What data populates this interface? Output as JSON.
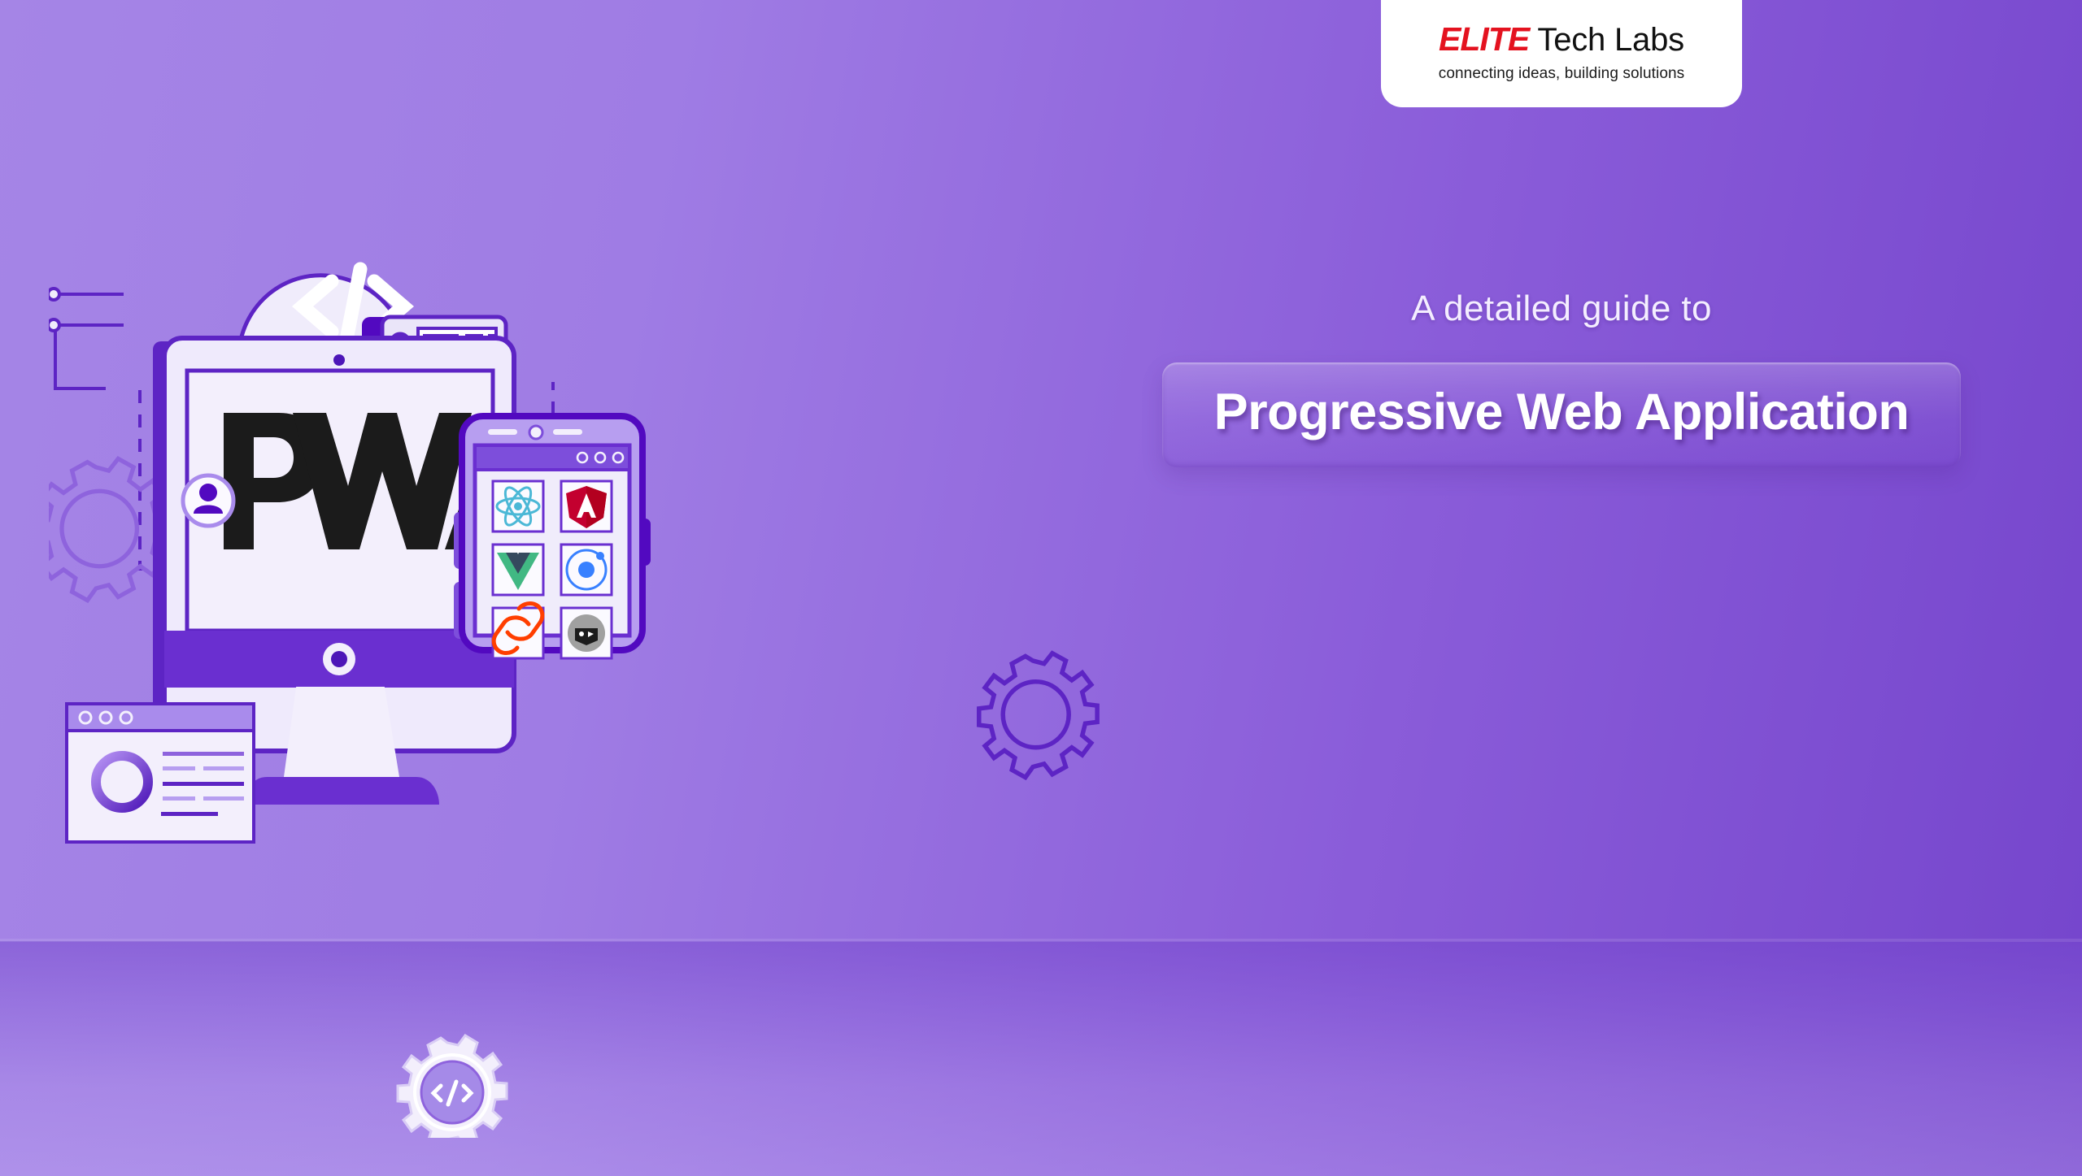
{
  "brand": {
    "logo_primary": "ELITE",
    "logo_secondary": " Tech Labs",
    "tagline": "connecting ideas, building solutions",
    "logo_red": "#e4121f",
    "logo_dark": "#111111"
  },
  "headline": {
    "eyebrow": "A detailed guide to",
    "title": "Progressive Web Application"
  },
  "colors": {
    "background_left": "#a585e6",
    "background_right": "#7545cc",
    "accent_purple": "#6a2fd0",
    "deep_purple": "#4d16b8",
    "panel_white": "#f0ecfb",
    "floor_overlay": "#b18ef0"
  },
  "illustration": {
    "screen_logo": "PWA",
    "code_symbol": "</>",
    "cloud_label": "cloud-node-network",
    "server_count": 3,
    "monitor": {
      "label": "desktop-monitor",
      "screen_text": "PWA"
    },
    "browser_card": {
      "label": "browser-window-card",
      "dots": 3,
      "chart": "donut-chart"
    },
    "phone": {
      "label": "smartphone",
      "browser_dots": 3,
      "app_tiles": [
        {
          "name": "react",
          "label": "React",
          "color": "#61dafb"
        },
        {
          "name": "angular",
          "label": "Angular",
          "color": "#c3002f"
        },
        {
          "name": "vue",
          "label": "Vue",
          "color": "#41b883"
        },
        {
          "name": "ionic",
          "label": "Ionic",
          "color": "#3880ff"
        },
        {
          "name": "svelte",
          "label": "Svelte",
          "color": "#ff3e00"
        },
        {
          "name": "polymer",
          "label": "Polymer",
          "color": "#9e9e9e"
        }
      ]
    },
    "gears": [
      {
        "name": "gear-outline-left",
        "style": "outline"
      },
      {
        "name": "gear-outline-right",
        "style": "outline"
      },
      {
        "name": "gear-code",
        "style": "solid",
        "symbol": "</>"
      }
    ],
    "avatar_badge": "user-avatar"
  }
}
